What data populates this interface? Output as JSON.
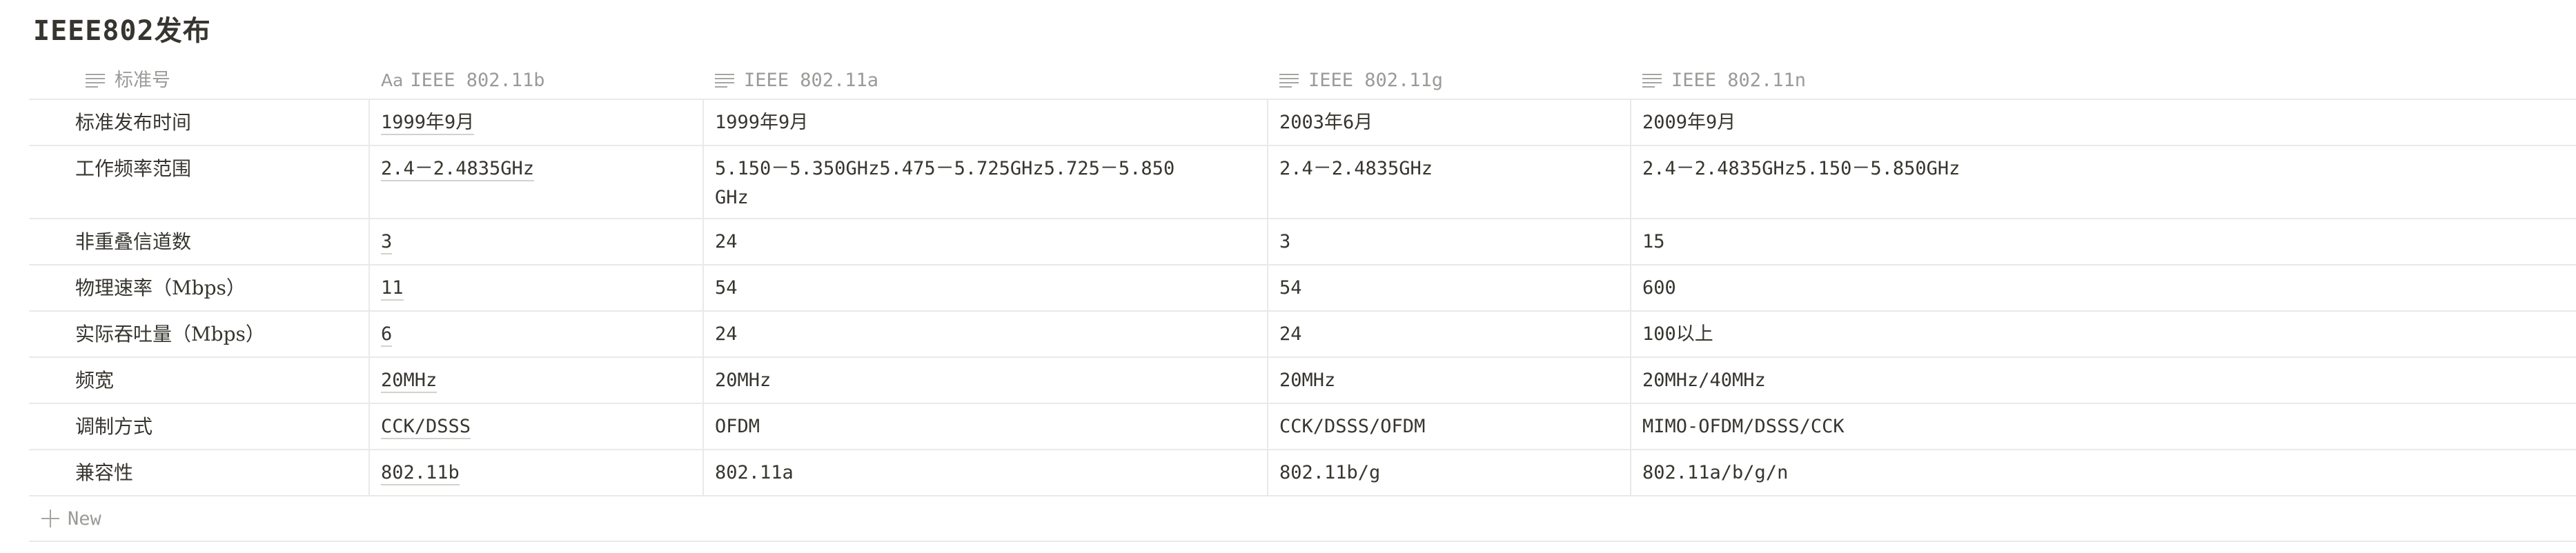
{
  "page": {
    "title": "IEEE802发布"
  },
  "table": {
    "columns": [
      {
        "label": "标准号",
        "icon": "text-lines-icon"
      },
      {
        "label": "IEEE 802.11b",
        "icon": "title-aa-icon"
      },
      {
        "label": "IEEE 802.11a",
        "icon": "text-lines-icon"
      },
      {
        "label": "IEEE 802.11g",
        "icon": "text-lines-icon"
      },
      {
        "label": "IEEE 802.11n",
        "icon": "text-lines-icon"
      }
    ],
    "rows": [
      [
        "标准发布时间",
        "1999年9月",
        "1999年9月",
        "2003年6月",
        "2009年9月"
      ],
      [
        "工作频率范围",
        "2.4－2.4835GHz",
        "5.150－5.350GHz5.475－5.725GHz5.725－5.850GHz",
        "2.4－2.4835GHz",
        "2.4－2.4835GHz5.150－5.850GHz"
      ],
      [
        "非重叠信道数",
        "3",
        "24",
        "3",
        "15"
      ],
      [
        "物理速率（Mbps）",
        "11",
        "54",
        "54",
        "600"
      ],
      [
        "实际吞吐量（Mbps）",
        "6",
        "24",
        "24",
        "100以上"
      ],
      [
        "频宽",
        "20MHz",
        "20MHz",
        "20MHz",
        "20MHz/40MHz"
      ],
      [
        "调制方式",
        "CCK/DSSS",
        "OFDM",
        "CCK/DSSS/OFDM",
        "MIMO-OFDM/DSSS/CCK"
      ],
      [
        "兼容性",
        "802.11b",
        "802.11a",
        "802.11b/g",
        "802.11a/b/g/n"
      ]
    ],
    "new_row_label": "New"
  }
}
